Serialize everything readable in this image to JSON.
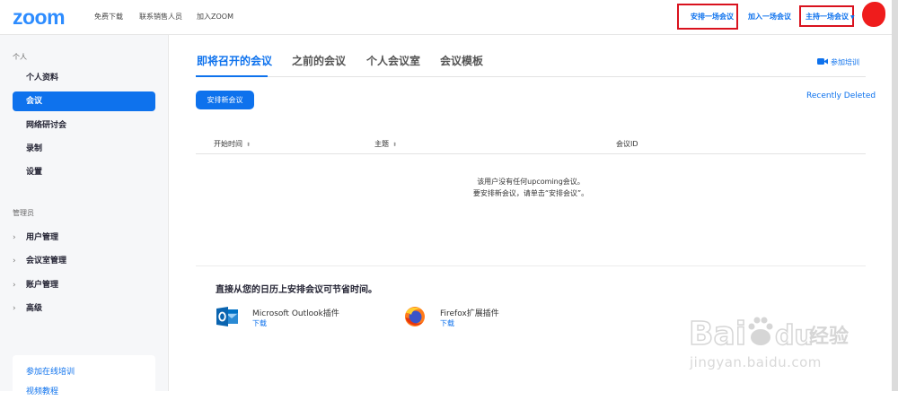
{
  "brand": {
    "logo_text": "zoom",
    "accent": "#0e72ed",
    "highlight": "#d9121e"
  },
  "topnav": {
    "links": [
      "免费下载",
      "联系销售人员",
      "加入ZOOM"
    ],
    "schedule": "安排一场会议",
    "join": "加入一场会议",
    "host": "主持一场会议"
  },
  "sidebar": {
    "personal_header": "个人",
    "items": [
      {
        "label": "个人资料"
      },
      {
        "label": "会议",
        "active": true
      },
      {
        "label": "网络研讨会"
      },
      {
        "label": "录制"
      },
      {
        "label": "设置"
      }
    ],
    "admin_header": "管理员",
    "admin_items": [
      {
        "label": "用户管理"
      },
      {
        "label": "会议室管理"
      },
      {
        "label": "账户管理"
      },
      {
        "label": "高级"
      }
    ],
    "card_links": [
      "参加在线培训",
      "视频教程"
    ]
  },
  "main": {
    "tabs": [
      "即将召开的会议",
      "之前的会议",
      "个人会议室",
      "会议模板"
    ],
    "active_tab": "即将召开的会议",
    "training_link": "参加培训",
    "schedule_button": "安排新会议",
    "recently_deleted": "Recently Deleted",
    "table_headers": [
      "开始时间",
      "主题",
      "会议ID"
    ],
    "empty_line1": "该用户没有任何upcoming会议。",
    "empty_line2": "要安排新会议，请单击“安排会议”。",
    "calendar_title": "直接从您的日历上安排会议可节省时间。",
    "plugins": [
      {
        "name": "Microsoft Outlook插件",
        "download": "下载",
        "icon": "outlook-icon"
      },
      {
        "name": "Firefox扩展插件",
        "download": "下载",
        "icon": "firefox-icon"
      }
    ]
  },
  "watermark": {
    "logo_text": "Bai du 经验",
    "url": "jingyan.baidu.com"
  }
}
